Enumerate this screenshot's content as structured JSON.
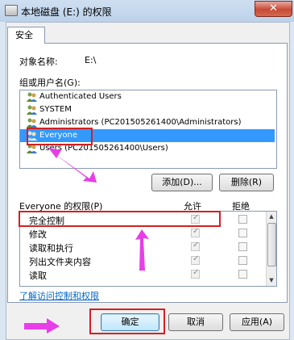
{
  "window": {
    "title": "本地磁盘 (E:) 的权限",
    "close_label": "✕"
  },
  "tabs": [
    "安全"
  ],
  "object": {
    "label": "对象名称:",
    "value": "E:\\"
  },
  "groups": {
    "label": "组或用户名(G):",
    "items": [
      "Authenticated Users",
      "SYSTEM",
      "Administrators (PC201505261400\\Administrators)",
      "Everyone",
      "Users (PC201505261400\\Users)"
    ],
    "selected_index": 3
  },
  "buttons": {
    "add": "添加(D)...",
    "remove": "删除(R)",
    "ok": "确定",
    "cancel": "取消",
    "apply": "应用(A)"
  },
  "permissions": {
    "header": "Everyone 的权限(P)",
    "allow_label": "允许",
    "deny_label": "拒绝",
    "rows": [
      {
        "name": "完全控制",
        "allow": true,
        "deny": false
      },
      {
        "name": "修改",
        "allow": true,
        "deny": false
      },
      {
        "name": "读取和执行",
        "allow": true,
        "deny": false
      },
      {
        "name": "列出文件夹内容",
        "allow": true,
        "deny": false
      },
      {
        "name": "读取",
        "allow": true,
        "deny": false
      }
    ]
  },
  "link": "了解访问控制和权限",
  "colors": {
    "annotation_red": "#d42020",
    "annotation_arrow": "#e83ee8",
    "selection": "#3399ff"
  }
}
